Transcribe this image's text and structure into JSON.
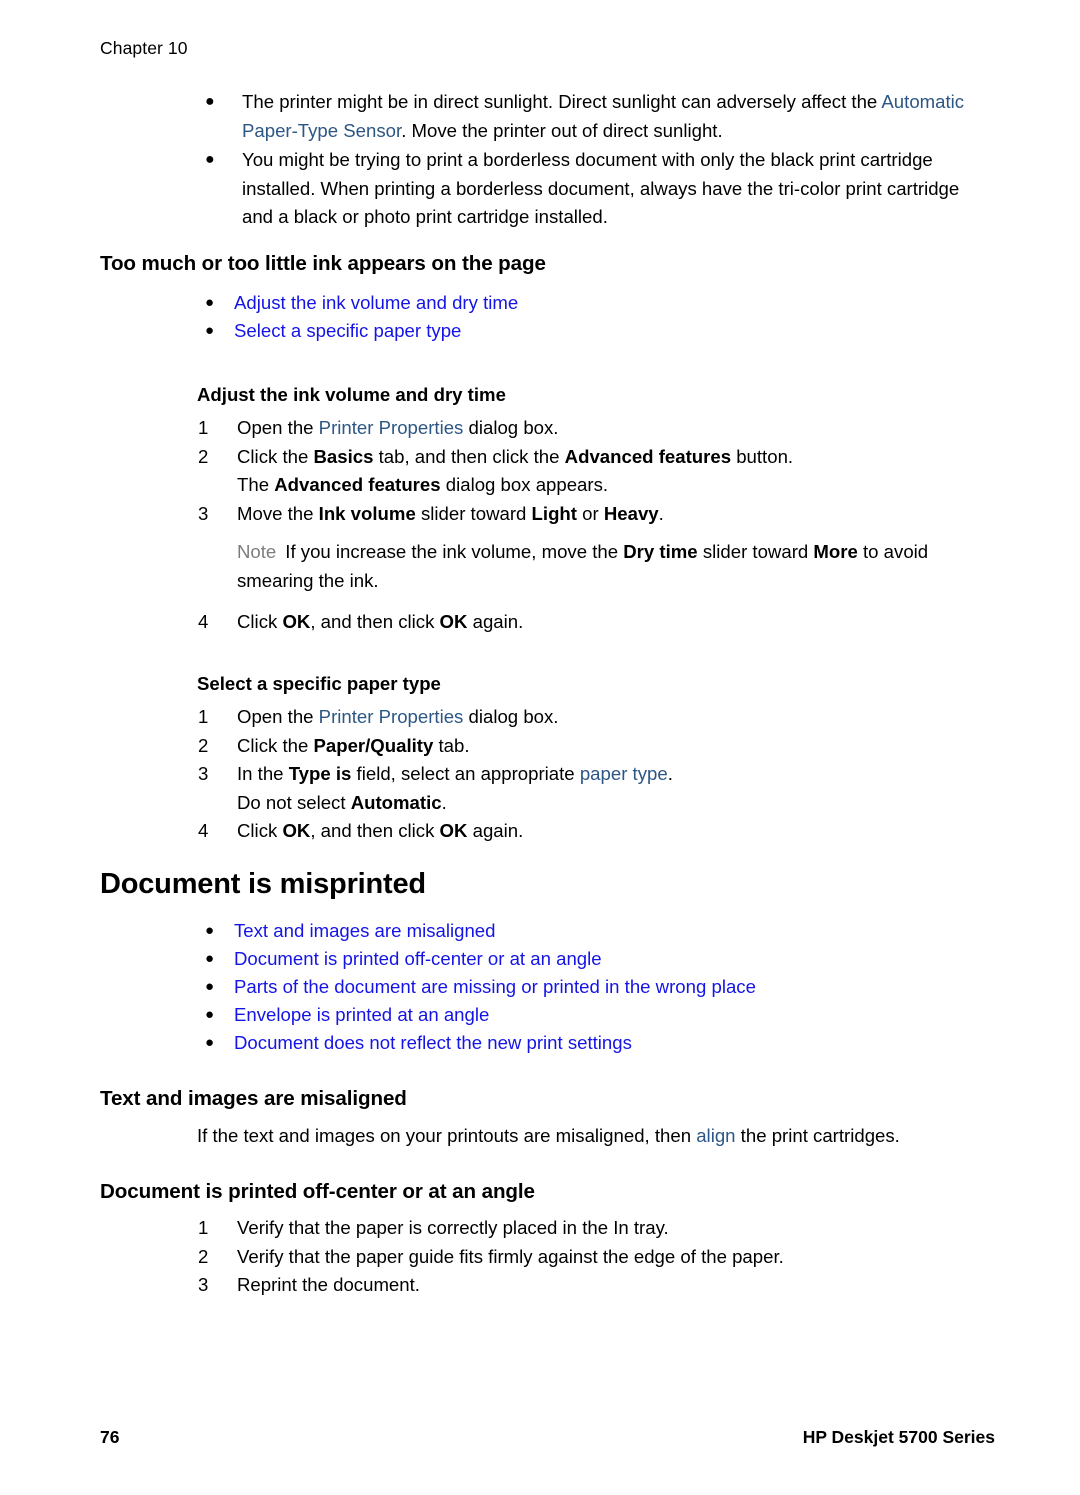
{
  "header": {
    "chapter": "Chapter 10"
  },
  "intro_bullets": [
    {
      "segments": [
        {
          "text": "The printer might be in direct sunlight. Direct sunlight can adversely affect the ",
          "style": "plain"
        },
        {
          "text": "Automatic Paper-Type Sensor",
          "style": "ilink"
        },
        {
          "text": ". Move the printer out of direct sunlight.",
          "style": "plain"
        }
      ]
    },
    {
      "segments": [
        {
          "text": "You might be trying to print a borderless document with only the black print cartridge installed. When printing a borderless document, always have the tri-color print cartridge and a black or photo print cartridge installed.",
          "style": "plain"
        }
      ]
    }
  ],
  "section_ink": {
    "heading": "Too much or too little ink appears on the page",
    "links": [
      "Adjust the ink volume and dry time",
      "Select a specific paper type"
    ],
    "proc1": {
      "heading": "Adjust the ink volume and dry time",
      "steps": [
        {
          "number": "1",
          "segments": [
            {
              "text": "Open the ",
              "style": "plain"
            },
            {
              "text": "Printer Properties",
              "style": "ilink"
            },
            {
              "text": " dialog box.",
              "style": "plain"
            }
          ]
        },
        {
          "number": "2",
          "segments": [
            {
              "text": "Click the ",
              "style": "plain"
            },
            {
              "text": "Basics",
              "style": "bold"
            },
            {
              "text": " tab, and then click the ",
              "style": "plain"
            },
            {
              "text": "Advanced features",
              "style": "bold"
            },
            {
              "text": " button.",
              "style": "plain"
            }
          ],
          "continuation": [
            {
              "text": "The ",
              "style": "plain"
            },
            {
              "text": "Advanced features",
              "style": "bold"
            },
            {
              "text": " dialog box appears.",
              "style": "plain"
            }
          ]
        },
        {
          "number": "3",
          "segments": [
            {
              "text": "Move the ",
              "style": "plain"
            },
            {
              "text": "Ink volume",
              "style": "bold"
            },
            {
              "text": " slider toward ",
              "style": "plain"
            },
            {
              "text": "Light",
              "style": "bold"
            },
            {
              "text": " or ",
              "style": "plain"
            },
            {
              "text": "Heavy",
              "style": "bold"
            },
            {
              "text": ".",
              "style": "plain"
            }
          ]
        }
      ],
      "note": {
        "label": "Note",
        "segments": [
          {
            "text": "If you increase the ink volume, move the ",
            "style": "plain"
          },
          {
            "text": "Dry time",
            "style": "bold"
          },
          {
            "text": " slider toward ",
            "style": "plain"
          },
          {
            "text": "More",
            "style": "bold"
          },
          {
            "text": " to avoid smearing the ink.",
            "style": "plain"
          }
        ]
      },
      "last_step": {
        "number": "4",
        "segments": [
          {
            "text": "Click ",
            "style": "plain"
          },
          {
            "text": "OK",
            "style": "bold"
          },
          {
            "text": ", and then click ",
            "style": "plain"
          },
          {
            "text": "OK",
            "style": "bold"
          },
          {
            "text": " again.",
            "style": "plain"
          }
        ]
      }
    },
    "proc2": {
      "heading": "Select a specific paper type",
      "steps": [
        {
          "number": "1",
          "segments": [
            {
              "text": "Open the ",
              "style": "plain"
            },
            {
              "text": "Printer Properties",
              "style": "ilink"
            },
            {
              "text": " dialog box.",
              "style": "plain"
            }
          ]
        },
        {
          "number": "2",
          "segments": [
            {
              "text": "Click the ",
              "style": "plain"
            },
            {
              "text": "Paper/Quality",
              "style": "bold"
            },
            {
              "text": " tab.",
              "style": "plain"
            }
          ]
        },
        {
          "number": "3",
          "segments": [
            {
              "text": "In the ",
              "style": "plain"
            },
            {
              "text": "Type is",
              "style": "bold"
            },
            {
              "text": " field, select an appropriate ",
              "style": "plain"
            },
            {
              "text": "paper type",
              "style": "ilink"
            },
            {
              "text": ".",
              "style": "plain"
            }
          ],
          "continuation": [
            {
              "text": "Do not select ",
              "style": "plain"
            },
            {
              "text": "Automatic",
              "style": "bold"
            },
            {
              "text": ".",
              "style": "plain"
            }
          ]
        },
        {
          "number": "4",
          "segments": [
            {
              "text": "Click ",
              "style": "plain"
            },
            {
              "text": "OK",
              "style": "bold"
            },
            {
              "text": ", and then click ",
              "style": "plain"
            },
            {
              "text": "OK",
              "style": "bold"
            },
            {
              "text": " again.",
              "style": "plain"
            }
          ]
        }
      ]
    }
  },
  "section_misprint": {
    "heading": "Document is misprinted",
    "links": [
      "Text and images are misaligned",
      "Document is printed off-center or at an angle",
      "Parts of the document are missing or printed in the wrong place",
      "Envelope is printed at an angle",
      "Document does not reflect the new print settings"
    ],
    "sub1": {
      "heading": "Text and images are misaligned",
      "paragraph": [
        {
          "text": "If the text and images on your printouts are misaligned, then ",
          "style": "plain"
        },
        {
          "text": "align",
          "style": "ilink"
        },
        {
          "text": " the print cartridges.",
          "style": "plain"
        }
      ]
    },
    "sub2": {
      "heading": "Document is printed off-center or at an angle",
      "steps": [
        {
          "number": "1",
          "segments": [
            {
              "text": "Verify that the paper is correctly placed in the In tray.",
              "style": "plain"
            }
          ]
        },
        {
          "number": "2",
          "segments": [
            {
              "text": "Verify that the paper guide fits firmly against the edge of the paper.",
              "style": "plain"
            }
          ]
        },
        {
          "number": "3",
          "segments": [
            {
              "text": "Reprint the document.",
              "style": "plain"
            }
          ]
        }
      ]
    }
  },
  "footer": {
    "page_number": "76",
    "product": "HP Deskjet 5700 Series"
  },
  "bullet_glyph": "●",
  "colors": {
    "cross_reference_link": "#1414E6",
    "inline_link": "#2C5683",
    "note_label": "#7D7D7D",
    "text": "#000000"
  }
}
